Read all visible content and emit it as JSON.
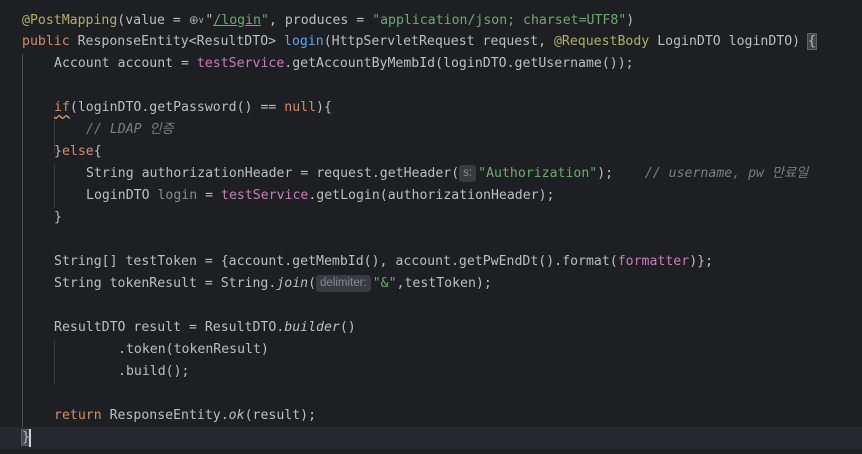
{
  "top_hint": "new",
  "lines": [
    {
      "tokens": [
        {
          "t": "@PostMapping",
          "c": "ann"
        },
        {
          "t": "(value = "
        },
        {
          "icon": "globe"
        },
        {
          "icon": "chevron-down"
        },
        {
          "t": "\""
        },
        {
          "t": "/login",
          "c": "link"
        },
        {
          "t": "\"",
          "c": "str"
        },
        {
          "t": ", produces = "
        },
        {
          "t": "\"application/json; charset=UTF8\"",
          "c": "str"
        },
        {
          "t": ")"
        }
      ]
    },
    {
      "tokens": [
        {
          "t": "public ",
          "c": "kw"
        },
        {
          "t": "ResponseEntity<ResultDTO> "
        },
        {
          "t": "login",
          "c": "fn"
        },
        {
          "t": "(HttpServletRequest request, "
        },
        {
          "t": "@RequestBody",
          "c": "ann"
        },
        {
          "t": " LoginDTO loginDTO) "
        },
        {
          "t": "{",
          "c": "bracket-hl"
        }
      ]
    },
    {
      "indent": 1,
      "tokens": [
        {
          "t": "Account account = "
        },
        {
          "t": "testService",
          "c": "fld"
        },
        {
          "t": ".getAccountByMembId(loginDTO.getUsername());"
        }
      ]
    },
    {
      "tokens": []
    },
    {
      "indent": 1,
      "tokens": [
        {
          "t": "if",
          "c": "kw wavy"
        },
        {
          "t": "(loginDTO.getPassword() == "
        },
        {
          "t": "null",
          "c": "kw"
        },
        {
          "t": "){"
        }
      ]
    },
    {
      "indent": 2,
      "tokens": [
        {
          "t": "// LDAP 인증",
          "c": "cm"
        }
      ]
    },
    {
      "indent": 1,
      "tokens": [
        {
          "t": "}"
        },
        {
          "t": "else",
          "c": "kw"
        },
        {
          "t": "{"
        }
      ]
    },
    {
      "indent": 2,
      "tokens": [
        {
          "t": "String authorizationHeader = request.getHeader("
        },
        {
          "hint": "s:"
        },
        {
          "t": "\"Authorization\"",
          "c": "str"
        },
        {
          "t": ");    "
        },
        {
          "t": "// username, pw 만료일",
          "c": "cm"
        }
      ]
    },
    {
      "indent": 2,
      "tokens": [
        {
          "t": "LoginDTO "
        },
        {
          "t": "login",
          "c": "unused"
        },
        {
          "t": " = "
        },
        {
          "t": "testService",
          "c": "fld"
        },
        {
          "t": ".getLogin(authorizationHeader);"
        }
      ]
    },
    {
      "indent": 1,
      "tokens": [
        {
          "t": "}"
        }
      ]
    },
    {
      "tokens": []
    },
    {
      "indent": 1,
      "tokens": [
        {
          "t": "String[] testToken = {account.getMembId(), account.getPwEndDt().format("
        },
        {
          "t": "formatter",
          "c": "fld"
        },
        {
          "t": ")};"
        }
      ]
    },
    {
      "indent": 1,
      "tokens": [
        {
          "t": "String tokenResult = String."
        },
        {
          "t": "join",
          "c": "it"
        },
        {
          "t": "("
        },
        {
          "hint": "delimiter:"
        },
        {
          "t": "\"&\"",
          "c": "str"
        },
        {
          "t": ",testToken);"
        }
      ]
    },
    {
      "tokens": []
    },
    {
      "indent": 1,
      "tokens": [
        {
          "t": "ResultDTO result = ResultDTO."
        },
        {
          "t": "builder",
          "c": "it"
        },
        {
          "t": "()"
        }
      ]
    },
    {
      "indent": 3,
      "tokens": [
        {
          "t": ".token(tokenResult)"
        }
      ]
    },
    {
      "indent": 3,
      "tokens": [
        {
          "t": ".build();"
        }
      ]
    },
    {
      "tokens": []
    },
    {
      "indent": 1,
      "tokens": [
        {
          "t": "return ",
          "c": "kw"
        },
        {
          "t": "ResponseEntity."
        },
        {
          "t": "ok",
          "c": "it"
        },
        {
          "t": "(result);"
        }
      ]
    },
    {
      "tokens": [
        {
          "t": "}",
          "c": "bracket-hl"
        }
      ]
    }
  ]
}
